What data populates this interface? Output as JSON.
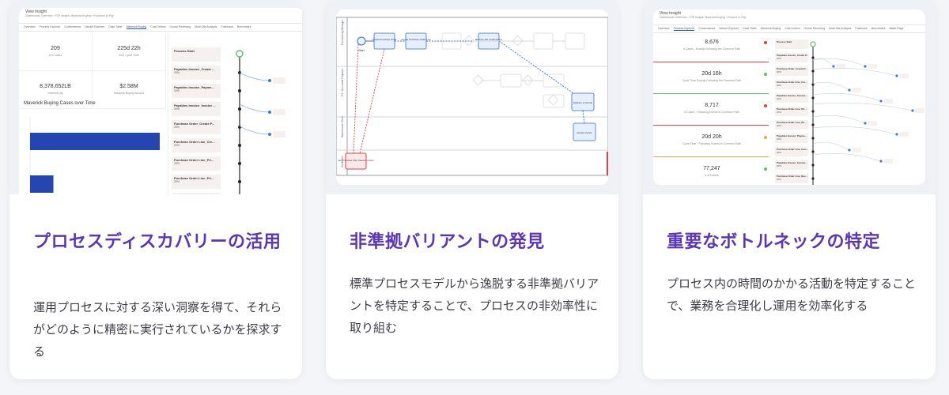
{
  "colors": {
    "title": "#5a37b8",
    "text": "#3d3d46",
    "bar": "#2446b0",
    "accent_blue": "#2a56b8",
    "red": "#e0404a",
    "green": "#58c06a",
    "orange": "#f0a04a"
  },
  "cards": [
    {
      "title": "プロセスディスカバリーの活用",
      "description": "運用プロセスに対する深い洞察を得て、それらがどのように精密に実行されているかを探求する",
      "screenshot": {
        "app_title": "View Insight",
        "breadcrumb": "Dashboards Overview  ›  P2P Insight: Maverick Buying  ›  Purchase to Pay",
        "tabs": [
          "Overview",
          "Process Explorer",
          "Conformance",
          "Variant Explorer",
          "Case Table",
          "Maverick Buying",
          "Cost Drivers",
          "Goods Receiving",
          "Multi Site Analysis",
          "Pushback",
          "Benchmark"
        ],
        "active_tab": "Maverick Buying",
        "kpis": [
          {
            "value": "209",
            "label": "# of Cases"
          },
          {
            "value": "225d 22h",
            "label": "AVG Cycle Time"
          },
          {
            "value": "8,378,652LB",
            "label": "Ordered Qty"
          },
          {
            "value": "$2.58M",
            "label": "Maverick Buying Amount"
          }
        ],
        "chart_title": "Maverick Buying Cases over Time",
        "chart_data": {
          "type": "bar",
          "orientation": "horizontal",
          "title": "Maverick Buying Cases over Time",
          "categories": [
            "",
            ""
          ],
          "values": [
            100,
            18
          ],
          "xlim": [
            0,
            100
          ]
        },
        "process_steps": [
          {
            "name": "Process Start",
            "pct": ""
          },
          {
            "name": "Payables Invoice_Create ...",
            "pct": "20%"
          },
          {
            "name": "Payables Invoice_Payme...",
            "pct": "20%"
          },
          {
            "name": "Payables Invoice_Invoice ...",
            "pct": "20%"
          },
          {
            "name": "Purchase Order_Create P...",
            "pct": "20%"
          },
          {
            "name": "Purchase Order Line_Cre...",
            "pct": "20%"
          },
          {
            "name": "Purchase Order Line_Pri...",
            "pct": "20%"
          },
          {
            "name": "Purchase Order Line_Pri...",
            "pct": "20%"
          },
          {
            "name": "Purchase Order Line_Invo...",
            "pct": "20%"
          }
        ]
      }
    },
    {
      "title": "非準拠バリアントの発見",
      "description": "標準プロセスモデルから逸脱する非準拠バリアントを特定することで、プロセスの非効率性に取り組む",
      "screenshot": {
        "lanes": [
          "Purchasing Manager",
          "P2 / Accounts Payable",
          "Warehouse Clerk",
          "Controller"
        ],
        "nodes": [
          "Start",
          "Create Purchase Order",
          "Create Purchase Order Line",
          "Receive PO Confirmation",
          "Delivery of Goods",
          "Create Invoice",
          "Send Purchase Order Maverick Invoice"
        ]
      }
    },
    {
      "title": "重要なボトルネックの特定",
      "description": "プロセス内の時間のかかる活動を特定することで、業務を合理化し運用を効率化する",
      "screenshot": {
        "app_title": "View Insight",
        "breadcrumb": "Dashboards Overview  ›  P2P Insight: Maverick Buying  ›  Procure to Pay",
        "tabs": [
          "Overview",
          "Process Explorer",
          "Conformance",
          "Variant Explorer",
          "Case Table",
          "Maverick Buying",
          "Cost Drivers",
          "Goods Receiving",
          "Multi Site Analysis",
          "Pushback",
          "Benchmark",
          "Blank Page"
        ],
        "active_tab": "Process Explorer",
        "stats": [
          {
            "value": "8,676",
            "label": "# Cases - Exactly Following the Common Path"
          },
          {
            "value": "20d 16h",
            "label": "Cycle Time Exactly Following the Common Path"
          },
          {
            "value": "8,717",
            "label": "# Cases - Following Events in Common Path"
          },
          {
            "value": "20d 20h",
            "label": "Cycle Time - Following Events in Common Path"
          },
          {
            "value": "77,247",
            "label": "# of Events"
          }
        ],
        "process_steps": [
          {
            "name": "Process Start",
            "pct": ""
          },
          {
            "name": "Payables Invoice_Create P...",
            "pct": "20%"
          },
          {
            "name": "Purchase Order_Create P...",
            "pct": "20%"
          },
          {
            "name": "Purchase Order Line_Cre...",
            "pct": "20%"
          },
          {
            "name": "Payables Invoice_Invoice...",
            "pct": "20%"
          },
          {
            "name": "Purchase Order Line_Pri...",
            "pct": "20%"
          },
          {
            "name": "Purchase Order Line_Pri...",
            "pct": "20%"
          },
          {
            "name": "Payables Invoice_Payme...",
            "pct": "20%"
          },
          {
            "name": "Purchase Order Line_Invo...",
            "pct": "20%"
          },
          {
            "name": "Payables Invoice_Invoice...",
            "pct": "20%"
          },
          {
            "name": "Purchase Order Line_Rec...",
            "pct": "20%"
          }
        ]
      }
    }
  ]
}
